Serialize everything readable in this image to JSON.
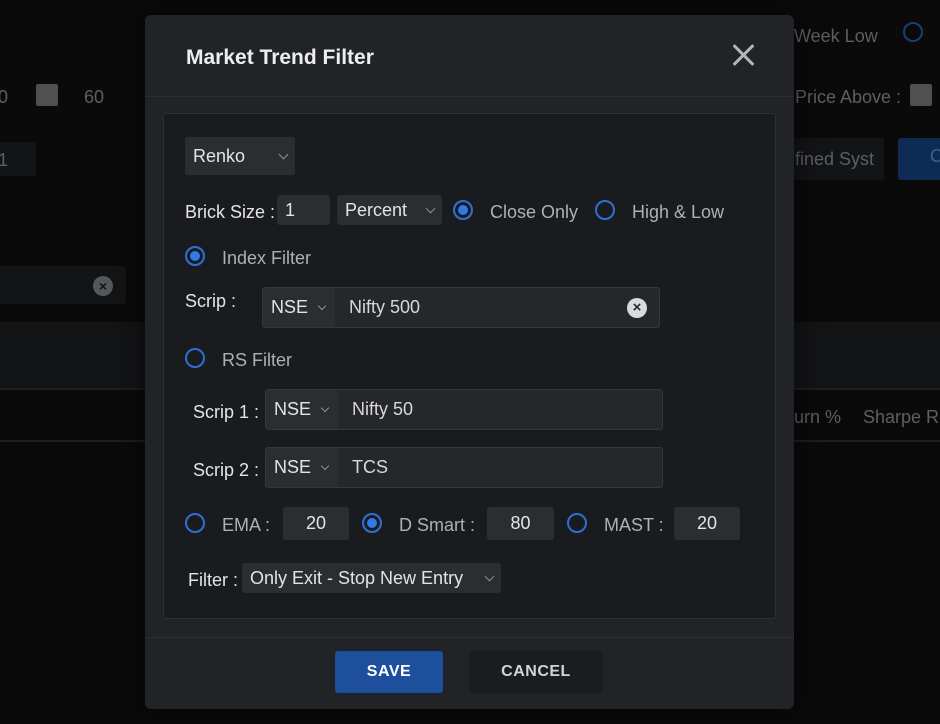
{
  "background": {
    "week_low": "Week Low",
    "price_above": "Price Above :",
    "num_left": "0",
    "num_60": "60",
    "num_1": "1",
    "defined_system": "fined Syst",
    "button_partial": "C",
    "return_col": "urn %",
    "sharpe_col": "Sharpe Re"
  },
  "modal": {
    "title": "Market Trend Filter",
    "chart_type": "Renko",
    "brick_size_label": "Brick Size :",
    "brick_size_value": "1",
    "brick_unit": "Percent",
    "close_only_label": "Close Only",
    "high_low_label": "High & Low",
    "index_filter_label": "Index Filter",
    "scrip_label": "Scrip :",
    "scrip_exchange": "NSE",
    "scrip_value": "Nifty 500",
    "rs_filter_label": "RS Filter",
    "scrip1_label": "Scrip 1 :",
    "scrip1_exchange": "NSE",
    "scrip1_value": "Nifty 50",
    "scrip2_label": "Scrip 2 :",
    "scrip2_exchange": "NSE",
    "scrip2_value": "TCS",
    "ema_label": "EMA :",
    "ema_value": "20",
    "dsmart_label": "D Smart :",
    "dsmart_value": "80",
    "mast_label": "MAST :",
    "mast_value": "20",
    "filter_label": "Filter :",
    "filter_value": "Only Exit - Stop New Entry",
    "save_label": "SAVE",
    "cancel_label": "CANCEL"
  },
  "state": {
    "brick_mode_selected": "Close Only",
    "filter_type_selected": "Index Filter",
    "indicator_selected": "D Smart"
  },
  "colors": {
    "accent": "#2f7ae5",
    "primary_button": "#1e4f9c",
    "modal_bg": "#222327",
    "page_bg": "#0a0a0b"
  }
}
